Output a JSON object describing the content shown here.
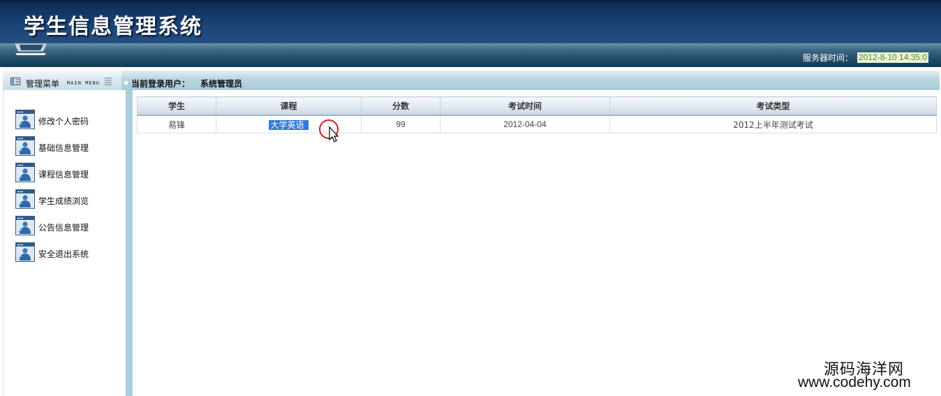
{
  "header": {
    "app_title": "学生信息管理系统",
    "server_time_label": "服务器时间：",
    "server_time_value": "2012-8-10 14:35:0"
  },
  "menu_bar": {
    "menu_title": "管理菜单",
    "menu_subtitle": "MAIN MENU",
    "login_label": "当前登录用户：",
    "login_user": "系统管理员"
  },
  "sidebar": {
    "items": [
      {
        "label": "修改个人密码",
        "icon": "user-window-icon"
      },
      {
        "label": "基础信息管理",
        "icon": "user-window-icon"
      },
      {
        "label": "课程信息管理",
        "icon": "user-window-icon"
      },
      {
        "label": "学生成绩浏览",
        "icon": "user-window-icon"
      },
      {
        "label": "公告信息管理",
        "icon": "user-window-icon"
      },
      {
        "label": "安全退出系统",
        "icon": "user-window-icon"
      }
    ]
  },
  "table": {
    "headers": [
      "学生",
      "课程",
      "分数",
      "考试时间",
      "考试类型"
    ],
    "rows": [
      {
        "student": "易锋",
        "course": "大学英语",
        "score": "99",
        "exam_date": "2012-04-04",
        "exam_type": "2012上半年测试考试"
      }
    ]
  },
  "watermark": {
    "cn": "源码海洋网",
    "url": "www.codehy.com"
  },
  "colors": {
    "header_dark": "#0d2b53",
    "band": "#1f4a66",
    "menu_bar": "#a8cbd9",
    "selection": "#3179d8",
    "server_time_text": "#4c8a1a"
  }
}
